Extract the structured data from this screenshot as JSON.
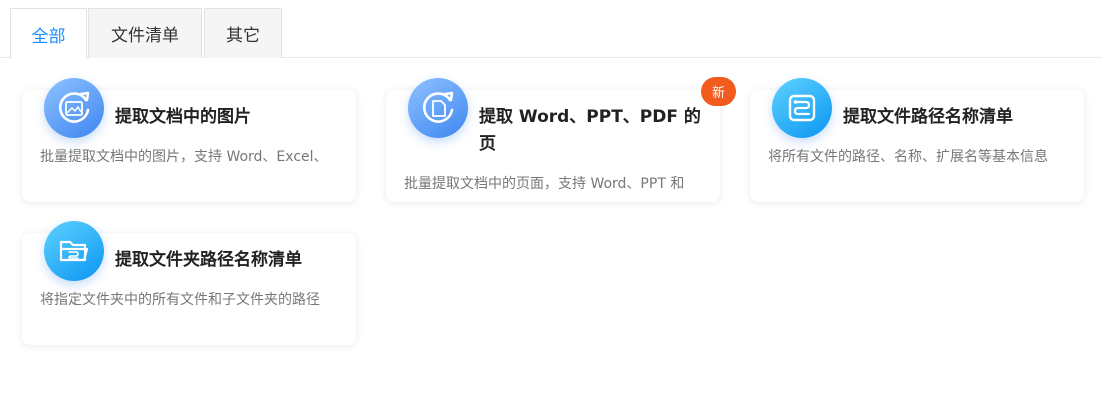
{
  "tabs": [
    {
      "label": "全部",
      "active": true
    },
    {
      "label": "文件清单",
      "active": false
    },
    {
      "label": "其它",
      "active": false
    }
  ],
  "cards": [
    {
      "title": "提取文档中的图片",
      "description": "批量提取文档中的图片，支持 Word、Excel、",
      "icon": "image-extract-icon"
    },
    {
      "title": "提取 Word、PPT、PDF 的页",
      "description": "批量提取文档中的页面，支持 Word、PPT 和",
      "icon": "page-extract-icon",
      "badge": "新"
    },
    {
      "title": "提取文件路径名称清单",
      "description": "将所有文件的路径、名称、扩展名等基本信息",
      "icon": "file-path-list-icon"
    },
    {
      "title": "提取文件夹路径名称清单",
      "description": "将指定文件夹中的所有文件和子文件夹的路径",
      "icon": "folder-path-list-icon"
    }
  ],
  "colors": {
    "accent": "#1890ff",
    "badge": "#f25a1e",
    "icon_blue": "#3d86f0",
    "icon_cyan": "#0a95f2"
  }
}
